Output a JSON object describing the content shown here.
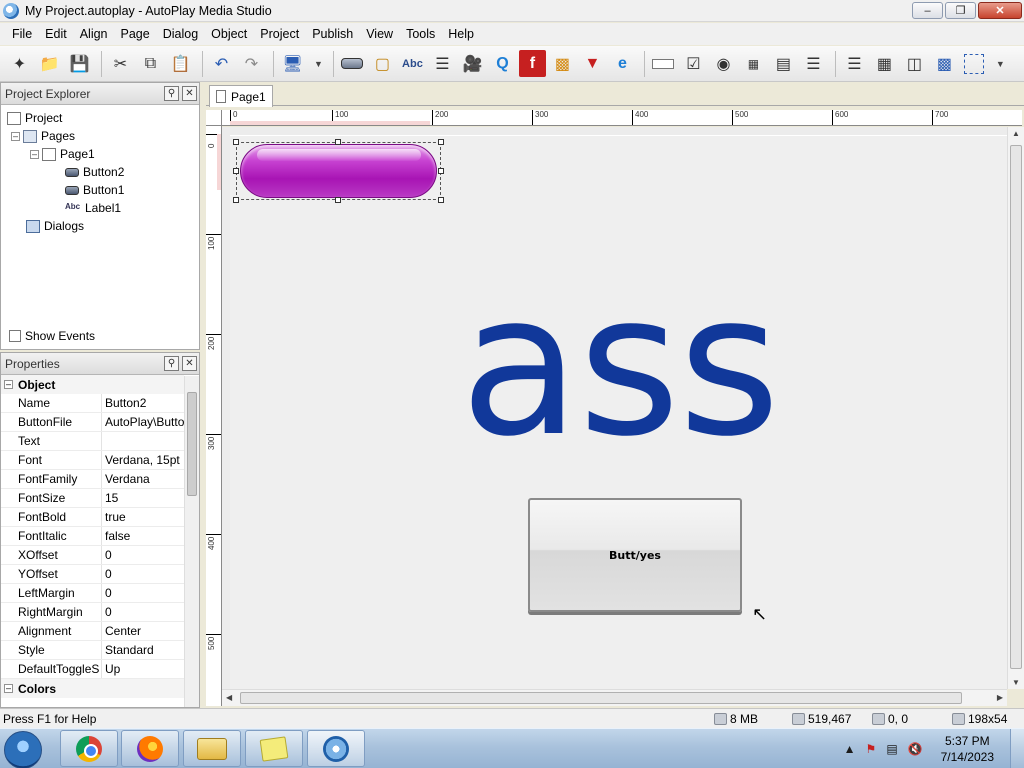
{
  "window": {
    "title": "My Project.autoplay - AutoPlay Media Studio"
  },
  "menu": [
    "File",
    "Edit",
    "Align",
    "Page",
    "Dialog",
    "Object",
    "Project",
    "Publish",
    "View",
    "Tools",
    "Help"
  ],
  "toolbar": {
    "buttons": [
      "new-project",
      "open",
      "save",
      "cut",
      "copy",
      "paste",
      "undo",
      "redo",
      "preview",
      "button-object",
      "image-object",
      "label-object",
      "paragraph-object",
      "video-object",
      "quicktime-object",
      "flash-object",
      "slideshow-object",
      "pdf-object",
      "web-object",
      "input-object",
      "checkbox-object",
      "radiobutton-object",
      "combobox-object",
      "listbox-object",
      "grid-object",
      "tree-object",
      "plugin-object",
      "selection-object"
    ],
    "label_icon_text": "Abc"
  },
  "project_explorer": {
    "title": "Project Explorer",
    "tree": [
      {
        "label": "Project",
        "icon": "project-icon"
      },
      {
        "label": "Pages",
        "icon": "pages-icon"
      },
      {
        "label": "Page1",
        "icon": "page-icon"
      },
      {
        "label": "Button2",
        "icon": "button-object-icon"
      },
      {
        "label": "Button1",
        "icon": "button-object-icon"
      },
      {
        "label": "Label1",
        "icon": "label-object-icon"
      },
      {
        "label": "Dialogs",
        "icon": "dialogs-icon"
      }
    ],
    "show_events": "Show Events"
  },
  "properties": {
    "title": "Properties",
    "group_object": "Object",
    "rows": [
      {
        "name": "Name",
        "value": "Button2"
      },
      {
        "name": "ButtonFile",
        "value": "AutoPlay\\Butto"
      },
      {
        "name": "Text",
        "value": ""
      },
      {
        "name": "Font",
        "value": "Verdana, 15pt"
      },
      {
        "name": "FontFamily",
        "value": "Verdana"
      },
      {
        "name": "FontSize",
        "value": "15"
      },
      {
        "name": "FontBold",
        "value": "true"
      },
      {
        "name": "FontItalic",
        "value": "false"
      },
      {
        "name": "XOffset",
        "value": "0"
      },
      {
        "name": "YOffset",
        "value": "0"
      },
      {
        "name": "LeftMargin",
        "value": "0"
      },
      {
        "name": "RightMargin",
        "value": "0"
      },
      {
        "name": "Alignment",
        "value": "Center"
      },
      {
        "name": "Style",
        "value": "Standard"
      },
      {
        "name": "DefaultToggleS",
        "value": "Up"
      }
    ],
    "group_colors": "Colors"
  },
  "document": {
    "tab": "Page1",
    "ruler_h": [
      "0",
      "100",
      "200",
      "300",
      "400",
      "500",
      "600",
      "700"
    ],
    "ruler_v": [
      "0",
      "100",
      "200",
      "300",
      "400",
      "500"
    ],
    "label_text": "ass",
    "button_text": "Butt/yes",
    "accent_purple": "#b01cbd",
    "label_color": "#11389a"
  },
  "status": {
    "help": "Press F1 for Help",
    "memory": "8 MB",
    "size_bytes": "519,467",
    "position": "0, 0",
    "dimensions": "198x54"
  },
  "taskbar": {
    "apps": [
      "Chrome",
      "Firefox",
      "Windows Explorer",
      "Sticky Notes",
      "AutoPlay Media Studio"
    ],
    "time": "5:37 PM",
    "date": "7/14/2023"
  }
}
